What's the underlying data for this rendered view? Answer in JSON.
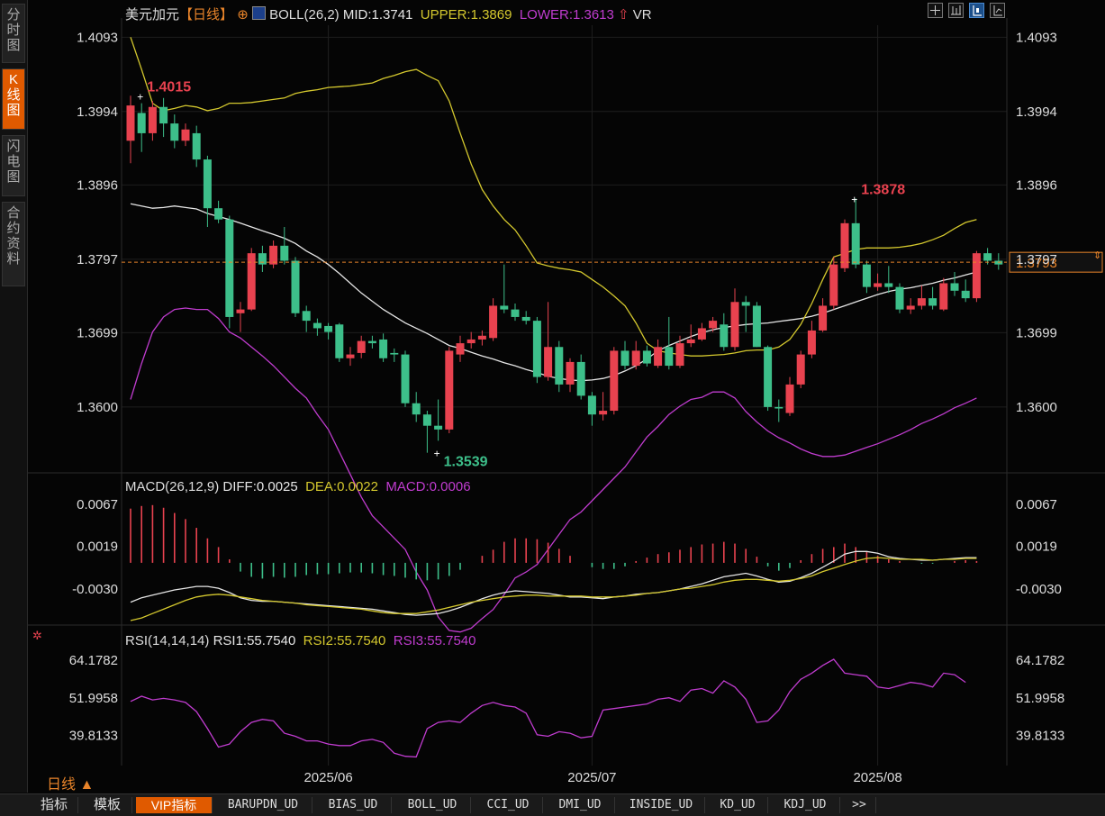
{
  "header": {
    "symbol": "美元加元",
    "period_tag": "【日线】",
    "boll_label": "BOLL(26,2)",
    "mid": "MID:1.3741",
    "upper": "UPPER:1.3869",
    "lower": "LOWER:1.3613",
    "vr": "VR"
  },
  "sidebar": {
    "tabs": [
      {
        "label": "分时图",
        "active": false
      },
      {
        "label": "K线图",
        "active": true
      },
      {
        "label": "闪电图",
        "active": false
      },
      {
        "label": "合约资料",
        "active": false
      }
    ]
  },
  "toolbar_icons": [
    "crosshair-icon",
    "bar-style-icon",
    "candle-style-icon",
    "line-style-icon"
  ],
  "period_label": "日线 ▲",
  "bottom_tabs": [
    "指标",
    "模板",
    "VIP指标",
    "BARUPDN_UD",
    "BIAS_UD",
    "BOLL_UD",
    "CCI_UD",
    "DMI_UD",
    "INSIDE_UD",
    "KD_UD",
    "KDJ_UD",
    ">>"
  ],
  "colors": {
    "up": "#e8424f",
    "down": "#3dbf8a",
    "mid": "#e6e6e6",
    "upper": "#d4c82e",
    "lower": "#c03ccf",
    "diff": "#e6e6e6",
    "dea": "#d4c82e",
    "rsi": "#c03ccf",
    "price_line": "#e8842a"
  },
  "chart_data": [
    {
      "type": "candlestick",
      "title": "BOLL(26,2)",
      "yticks": [
        "1.4093",
        "1.3994",
        "1.3896",
        "1.3797",
        "1.3699",
        "1.3600"
      ],
      "ylim": [
        1.3523,
        1.4109
      ],
      "xlabels": [
        {
          "label": "2025/06",
          "index": 18
        },
        {
          "label": "2025/07",
          "index": 42
        },
        {
          "label": "2025/08",
          "index": 68
        }
      ],
      "current_price": "1.3793",
      "annotations": [
        {
          "label": "1.4015",
          "index": 1,
          "value": 1.4015,
          "kind": "high"
        },
        {
          "label": "1.3878",
          "index": 66,
          "value": 1.3878,
          "kind": "high"
        },
        {
          "label": "1.3539",
          "index": 28,
          "value": 1.3539,
          "kind": "low"
        }
      ],
      "candles": [
        [
          1.3955,
          1.4002,
          1.4015,
          1.3925
        ],
        [
          1.3992,
          1.3965,
          1.4005,
          1.394
        ],
        [
          1.3965,
          1.4,
          1.4008,
          1.3955
        ],
        [
          1.4,
          1.3978,
          1.4012,
          1.396
        ],
        [
          1.3978,
          1.3955,
          1.399,
          1.3945
        ],
        [
          1.3955,
          1.397,
          1.3978,
          1.3948
        ],
        [
          1.3965,
          1.393,
          1.3975,
          1.392
        ],
        [
          1.393,
          1.3865,
          1.3935,
          1.384
        ],
        [
          1.3865,
          1.385,
          1.3875,
          1.3845
        ],
        [
          1.385,
          1.372,
          1.3855,
          1.3705
        ],
        [
          1.3725,
          1.373,
          1.374,
          1.37
        ],
        [
          1.373,
          1.3805,
          1.3812,
          1.3728
        ],
        [
          1.3805,
          1.379,
          1.3815,
          1.378
        ],
        [
          1.379,
          1.3815,
          1.3822,
          1.3785
        ],
        [
          1.3815,
          1.3795,
          1.384,
          1.379
        ],
        [
          1.3795,
          1.3725,
          1.38,
          1.372
        ],
        [
          1.3728,
          1.3715,
          1.3735,
          1.37
        ],
        [
          1.3712,
          1.3705,
          1.3718,
          1.3695
        ],
        [
          1.3708,
          1.37,
          1.3712,
          1.369
        ],
        [
          1.371,
          1.3665,
          1.3712,
          1.366
        ],
        [
          1.3665,
          1.367,
          1.368,
          1.3655
        ],
        [
          1.3672,
          1.3688,
          1.3695,
          1.3665
        ],
        [
          1.3688,
          1.3685,
          1.3695,
          1.3678
        ],
        [
          1.369,
          1.3665,
          1.3698,
          1.366
        ],
        [
          1.3672,
          1.367,
          1.3678,
          1.366
        ],
        [
          1.367,
          1.3605,
          1.3675,
          1.36
        ],
        [
          1.3605,
          1.359,
          1.362,
          1.358
        ],
        [
          1.359,
          1.3575,
          1.3595,
          1.3539
        ],
        [
          1.3575,
          1.357,
          1.361,
          1.3555
        ],
        [
          1.357,
          1.3675,
          1.368,
          1.3565
        ],
        [
          1.367,
          1.3685,
          1.3695,
          1.366
        ],
        [
          1.3685,
          1.369,
          1.37,
          1.3678
        ],
        [
          1.369,
          1.3695,
          1.3702,
          1.3682
        ],
        [
          1.3692,
          1.3735,
          1.3745,
          1.3688
        ],
        [
          1.3735,
          1.373,
          1.379,
          1.3725
        ],
        [
          1.373,
          1.372,
          1.3738,
          1.3715
        ],
        [
          1.372,
          1.3715,
          1.3728,
          1.371
        ],
        [
          1.3715,
          1.364,
          1.372,
          1.3632
        ],
        [
          1.364,
          1.368,
          1.374,
          1.3635
        ],
        [
          1.368,
          1.363,
          1.3688,
          1.362
        ],
        [
          1.363,
          1.366,
          1.3665,
          1.362
        ],
        [
          1.366,
          1.3615,
          1.367,
          1.361
        ],
        [
          1.3615,
          1.359,
          1.362,
          1.3575
        ],
        [
          1.359,
          1.3595,
          1.362,
          1.3582
        ],
        [
          1.3595,
          1.3675,
          1.368,
          1.359
        ],
        [
          1.3675,
          1.3655,
          1.3688,
          1.365
        ],
        [
          1.3655,
          1.3675,
          1.3688,
          1.365
        ],
        [
          1.3675,
          1.3658,
          1.3682,
          1.3654
        ],
        [
          1.3655,
          1.368,
          1.369,
          1.3652
        ],
        [
          1.368,
          1.3655,
          1.372,
          1.365
        ],
        [
          1.3655,
          1.3685,
          1.3695,
          1.3652
        ],
        [
          1.3685,
          1.369,
          1.371,
          1.368
        ],
        [
          1.369,
          1.3705,
          1.3712,
          1.3688
        ],
        [
          1.3705,
          1.3715,
          1.372,
          1.37
        ],
        [
          1.371,
          1.368,
          1.3725,
          1.3675
        ],
        [
          1.368,
          1.374,
          1.3758,
          1.3675
        ],
        [
          1.374,
          1.3735,
          1.3748,
          1.37
        ],
        [
          1.3735,
          1.368,
          1.374,
          1.368
        ],
        [
          1.368,
          1.36,
          1.3682,
          1.3595
        ],
        [
          1.36,
          1.3598,
          1.361,
          1.358
        ],
        [
          1.3592,
          1.363,
          1.364,
          1.3588
        ],
        [
          1.363,
          1.367,
          1.3675,
          1.3625
        ],
        [
          1.367,
          1.3702,
          1.3715,
          1.3665
        ],
        [
          1.3702,
          1.3735,
          1.3745,
          1.37
        ],
        [
          1.3735,
          1.379,
          1.38,
          1.373
        ],
        [
          1.3785,
          1.3845,
          1.385,
          1.378
        ],
        [
          1.3845,
          1.379,
          1.3878,
          1.3785
        ],
        [
          1.379,
          1.376,
          1.3795,
          1.3752
        ],
        [
          1.376,
          1.3765,
          1.3778,
          1.3755
        ],
        [
          1.3765,
          1.376,
          1.3788,
          1.3752
        ],
        [
          1.376,
          1.373,
          1.3765,
          1.3725
        ],
        [
          1.373,
          1.3735,
          1.3745,
          1.3724
        ],
        [
          1.3735,
          1.3745,
          1.3762,
          1.373
        ],
        [
          1.3745,
          1.3735,
          1.376,
          1.373
        ],
        [
          1.373,
          1.3765,
          1.3772,
          1.3728
        ],
        [
          1.3765,
          1.3755,
          1.378,
          1.3748
        ],
        [
          1.3755,
          1.3745,
          1.377,
          1.374
        ],
        [
          1.3745,
          1.3805,
          1.3808,
          1.374
        ],
        [
          1.3805,
          1.3795,
          1.3812,
          1.379
        ],
        [
          1.3795,
          1.379,
          1.3805,
          1.3783
        ]
      ],
      "series": [
        {
          "name": "MID",
          "values": [
            1.3871,
            1.3868,
            1.3865,
            1.3866,
            1.3868,
            1.3866,
            1.3864,
            1.3858,
            1.3854,
            1.385,
            1.3845,
            1.384,
            1.3835,
            1.383,
            1.3825,
            1.3818,
            1.3808,
            1.38,
            1.379,
            1.3778,
            1.3765,
            1.3752,
            1.3741,
            1.373,
            1.3721,
            1.3712,
            1.3705,
            1.3698,
            1.369,
            1.3682,
            1.3678,
            1.3673,
            1.3668,
            1.3664,
            1.3659,
            1.3655,
            1.365,
            1.3646,
            1.3641,
            1.3638,
            1.3636,
            1.3635,
            1.3636,
            1.3638,
            1.3642,
            1.3648,
            1.3655,
            1.3664,
            1.3675,
            1.3682,
            1.3688,
            1.3694,
            1.3699,
            1.3703,
            1.3706,
            1.3708,
            1.371,
            1.3711,
            1.3712,
            1.3714,
            1.3716,
            1.3718,
            1.3721,
            1.3725,
            1.373,
            1.3735,
            1.374,
            1.3745,
            1.375,
            1.3754,
            1.3757,
            1.3759,
            1.3762,
            1.3765,
            1.3769,
            1.3772,
            1.3776,
            1.378
          ]
        },
        {
          "name": "UPPER",
          "values": [
            1.4093,
            1.405,
            1.4005,
            1.3995,
            1.3998,
            1.4002,
            1.4,
            1.3995,
            1.3998,
            1.4005,
            1.4005,
            1.4006,
            1.4008,
            1.401,
            1.4012,
            1.4018,
            1.4021,
            1.4023,
            1.4026,
            1.4027,
            1.4028,
            1.403,
            1.4032,
            1.4038,
            1.4042,
            1.4047,
            1.405,
            1.4042,
            1.4035,
            1.4008,
            1.3965,
            1.3924,
            1.389,
            1.3868,
            1.385,
            1.3836,
            1.3815,
            1.3792,
            1.3788,
            1.3785,
            1.3783,
            1.378,
            1.377,
            1.376,
            1.3748,
            1.3735,
            1.3712,
            1.3685,
            1.3675,
            1.3672,
            1.367,
            1.3668,
            1.3668,
            1.3669,
            1.367,
            1.3672,
            1.3675,
            1.3676,
            1.3676,
            1.368,
            1.369,
            1.371,
            1.3738,
            1.377,
            1.38,
            1.3805,
            1.381,
            1.3812,
            1.3812,
            1.3812,
            1.3813,
            1.3815,
            1.3818,
            1.3823,
            1.3829,
            1.3838,
            1.3846,
            1.385
          ]
        },
        {
          "name": "LOWER",
          "values": [
            1.361,
            1.3658,
            1.37,
            1.372,
            1.373,
            1.3732,
            1.373,
            1.373,
            1.3718,
            1.37,
            1.3692,
            1.368,
            1.3668,
            1.3655,
            1.364,
            1.3625,
            1.3612,
            1.359,
            1.357,
            1.354,
            1.351,
            1.348,
            1.3455,
            1.344,
            1.3425,
            1.341,
            1.338,
            1.3356,
            1.332,
            1.3302,
            1.33,
            1.3305,
            1.3318,
            1.333,
            1.335,
            1.3372,
            1.338,
            1.339,
            1.341,
            1.343,
            1.345,
            1.346,
            1.3475,
            1.349,
            1.3505,
            1.352,
            1.354,
            1.356,
            1.3574,
            1.359,
            1.3601,
            1.361,
            1.3613,
            1.362,
            1.362,
            1.3612,
            1.3594,
            1.358,
            1.3568,
            1.3559,
            1.3552,
            1.3544,
            1.3538,
            1.3534,
            1.3534,
            1.3536,
            1.3541,
            1.3546,
            1.3551,
            1.3557,
            1.3563,
            1.357,
            1.3578,
            1.3584,
            1.3591,
            1.3599,
            1.3605,
            1.3612
          ]
        }
      ]
    },
    {
      "type": "bar+line",
      "title": "MACD(26,12,9)",
      "diff_text": "DIFF:0.0025",
      "dea_text": "DEA:0.0022",
      "macd_text": "MACD:0.0006",
      "yticks": [
        "0.0067",
        "0.0019",
        "-0.0030"
      ],
      "ylim": [
        -0.0065,
        0.0072
      ],
      "macd": [
        0.0062,
        0.0065,
        0.0066,
        0.0063,
        0.0057,
        0.005,
        0.004,
        0.0028,
        0.0018,
        0.0004,
        -0.001,
        -0.0016,
        -0.0018,
        -0.0016,
        -0.0017,
        -0.0016,
        -0.0014,
        -0.0013,
        -0.0013,
        -0.0012,
        -0.0011,
        -0.0011,
        -0.0012,
        -0.0014,
        -0.0015,
        -0.0017,
        -0.0019,
        -0.002,
        -0.0019,
        -0.0015,
        -0.0008,
        0.0,
        0.0008,
        0.0015,
        0.0024,
        0.0028,
        0.0028,
        0.0027,
        0.0023,
        0.0016,
        0.0008,
        0.0,
        -0.0005,
        -0.0007,
        -0.0007,
        -0.0004,
        0.0002,
        0.0006,
        0.001,
        0.0012,
        0.0015,
        0.0018,
        0.0021,
        0.0022,
        0.0024,
        0.0022,
        0.0016,
        0.0007,
        -0.0004,
        -0.0009,
        -0.0006,
        0.0003,
        0.001,
        0.0016,
        0.0018,
        0.0022,
        0.0018,
        0.0013,
        0.0008,
        0.0004,
        0.0002,
        0.0,
        -0.0001,
        -0.0001,
        0.0,
        0.0002,
        0.0003,
        0.0002
      ],
      "diff": [
        -0.0045,
        -0.004,
        -0.0037,
        -0.0034,
        -0.0031,
        -0.0029,
        -0.0027,
        -0.0027,
        -0.0029,
        -0.0034,
        -0.004,
        -0.0043,
        -0.0044,
        -0.0044,
        -0.0045,
        -0.0046,
        -0.0047,
        -0.0048,
        -0.0049,
        -0.005,
        -0.0051,
        -0.0052,
        -0.0053,
        -0.0055,
        -0.0057,
        -0.0059,
        -0.006,
        -0.0059,
        -0.0058,
        -0.0055,
        -0.0051,
        -0.0046,
        -0.0041,
        -0.0037,
        -0.0034,
        -0.0032,
        -0.0033,
        -0.0034,
        -0.0035,
        -0.0037,
        -0.0039,
        -0.0039,
        -0.004,
        -0.0041,
        -0.0039,
        -0.0038,
        -0.0036,
        -0.0035,
        -0.0034,
        -0.0032,
        -0.003,
        -0.0027,
        -0.0024,
        -0.002,
        -0.0016,
        -0.0014,
        -0.0012,
        -0.0015,
        -0.0019,
        -0.0022,
        -0.0021,
        -0.0017,
        -0.0012,
        -0.0005,
        0.0002,
        0.001,
        0.0013,
        0.0013,
        0.0011,
        0.0007,
        0.0005,
        0.0004,
        0.0003,
        0.0003,
        0.0004,
        0.0005,
        0.0006,
        0.0006
      ],
      "dea": [
        -0.0066,
        -0.0063,
        -0.0058,
        -0.0053,
        -0.0048,
        -0.0043,
        -0.0039,
        -0.0037,
        -0.0036,
        -0.0037,
        -0.0039,
        -0.0041,
        -0.0043,
        -0.0044,
        -0.0045,
        -0.0046,
        -0.0048,
        -0.0049,
        -0.005,
        -0.0051,
        -0.0052,
        -0.0053,
        -0.0055,
        -0.0057,
        -0.0058,
        -0.0058,
        -0.0058,
        -0.0056,
        -0.0054,
        -0.0051,
        -0.0048,
        -0.0045,
        -0.0043,
        -0.0041,
        -0.0039,
        -0.0038,
        -0.0037,
        -0.0037,
        -0.0038,
        -0.0038,
        -0.0038,
        -0.0038,
        -0.0039,
        -0.0039,
        -0.0039,
        -0.0038,
        -0.0037,
        -0.0035,
        -0.0034,
        -0.0032,
        -0.003,
        -0.0029,
        -0.0027,
        -0.0025,
        -0.0022,
        -0.002,
        -0.0019,
        -0.0019,
        -0.002,
        -0.0021,
        -0.002,
        -0.0018,
        -0.0015,
        -0.001,
        -0.0006,
        -0.0002,
        0.0002,
        0.0005,
        0.0006,
        0.0005,
        0.0004,
        0.0004,
        0.0004,
        0.0003,
        0.0004,
        0.0004,
        0.0005,
        0.0005
      ]
    },
    {
      "type": "line",
      "title": "RSI(14,14,14)",
      "rsi1_text": "RSI1:55.7540",
      "rsi2_text": "RSI2:55.7540",
      "rsi3_text": "RSI3:55.7540",
      "yticks": [
        "64.1782",
        "51.9958",
        "39.8133"
      ],
      "ylim": [
        30.0,
        68.0
      ],
      "rsi": [
        50.8,
        52.5,
        51.3,
        51.8,
        51.3,
        50.5,
        47.5,
        42.0,
        36.0,
        37.0,
        41.0,
        44.0,
        45.0,
        44.5,
        40.5,
        39.5,
        38.0,
        38.0,
        37.0,
        36.5,
        36.5,
        38.0,
        38.5,
        37.5,
        34.0,
        33.0,
        32.8,
        42.0,
        44.0,
        44.5,
        44.0,
        47.0,
        49.5,
        50.5,
        49.5,
        49.0,
        47.0,
        40.0,
        39.5,
        41.0,
        40.5,
        39.0,
        39.5,
        48.0,
        48.5,
        49.0,
        49.5,
        50.0,
        51.5,
        52.0,
        50.8,
        54.5,
        55.0,
        53.5,
        57.5,
        55.5,
        51.5,
        44.0,
        44.5,
        48.0,
        54.0,
        58.0,
        60.0,
        62.5,
        64.5,
        60.0,
        59.5,
        59.0,
        55.5,
        55.0,
        56.0,
        57.0,
        56.5,
        55.5,
        60.0,
        59.5,
        57.0
      ]
    }
  ]
}
